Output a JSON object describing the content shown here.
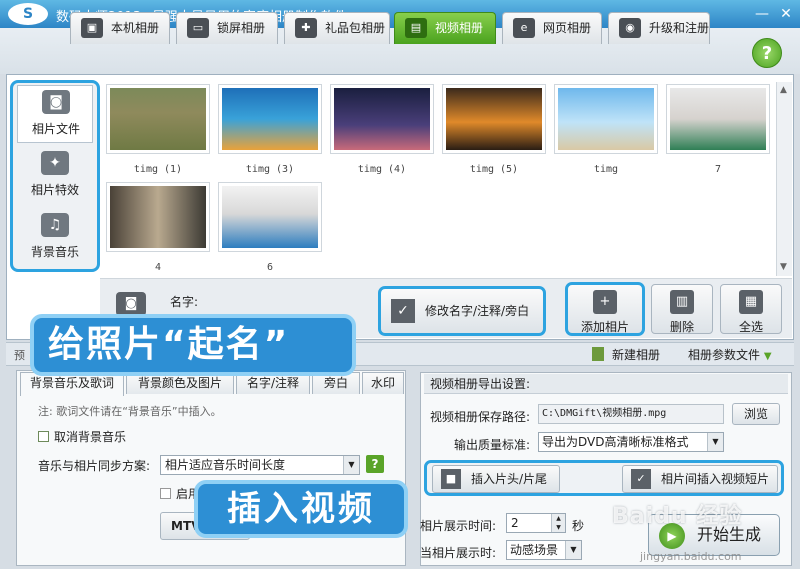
{
  "titlebar": {
    "app_name": "数码大师2013",
    "subtitle": "最强大最易用的家庭相册制作软件",
    "logo": "S",
    "minimize": "—",
    "close": "✕"
  },
  "tabs": [
    {
      "label": "本机相册",
      "icon": "computer-icon"
    },
    {
      "label": "锁屏相册",
      "icon": "monitor-icon"
    },
    {
      "label": "礼品包相册",
      "icon": "gift-icon"
    },
    {
      "label": "视频相册",
      "icon": "film-icon",
      "active": true
    },
    {
      "label": "网页相册",
      "icon": "ie-icon"
    },
    {
      "label": "升级和注册",
      "icon": "globe-icon"
    }
  ],
  "help": "?",
  "sidebar": {
    "items": [
      {
        "label": "相片文件",
        "icon": "camera-icon",
        "glyph": "◙",
        "active": true
      },
      {
        "label": "相片特效",
        "icon": "effects-icon",
        "glyph": "✦"
      },
      {
        "label": "背景音乐",
        "icon": "music-icon",
        "glyph": "♫"
      }
    ]
  },
  "gallery": {
    "photos": [
      {
        "caption": "timg (1)",
        "thumb": "sheep-herd-field"
      },
      {
        "caption": "timg (3)",
        "thumb": "underwater-coral-fish"
      },
      {
        "caption": "timg (4)",
        "thumb": "mountain-starry-sky"
      },
      {
        "caption": "timg (5)",
        "thumb": "sunset-clouds"
      },
      {
        "caption": "timg",
        "thumb": "beach-people"
      },
      {
        "caption": "7",
        "thumb": "billiards-man"
      },
      {
        "caption": "4",
        "thumb": "billiards-woman-cue"
      },
      {
        "caption": "6",
        "thumb": "billiards-woman-table"
      }
    ]
  },
  "name_label": "名字:",
  "buttons": {
    "rename": "修改名字/注释/旁白",
    "add_photo": "添加相片",
    "delete": "删除",
    "select_all": "全选"
  },
  "overlays": {
    "name_photo": "给照片“起名”",
    "insert_video": "插入视频"
  },
  "midbar": {
    "label": "预",
    "new_album": "新建相册",
    "album_params": "相册参数文件"
  },
  "settings_tabs": [
    "背景音乐及歌词",
    "背景颜色及图片",
    "名字/注释",
    "旁白",
    "水印"
  ],
  "music": {
    "note": "注: 歌词文件请在“背景音乐”中插入。",
    "cancel_music": "取消背景音乐",
    "sync_label": "音乐与相片同步方案:",
    "sync_value": "相片适应音乐时间长度",
    "help": "?",
    "enable_label": "启用",
    "mtv_label": "MTV"
  },
  "export": {
    "title": "视频相册导出设置:",
    "path_label": "视频相册保存路径:",
    "path_value": "C:\\DMGift\\视频相册.mpg",
    "browse": "浏览",
    "quality_label": "输出质量标准:",
    "quality_value": "导出为DVD高清晰标准格式",
    "insert_head": "插入片头/片尾",
    "insert_clip": "相片间插入视频短片",
    "duration_label": "相片展示时间:",
    "duration_value": "2",
    "duration_unit": "秒",
    "current_duration_label": "当相片展示时:",
    "current_duration_value": "动感场景",
    "generate": "开始生成"
  },
  "watermark": {
    "main": "Baidu 经验",
    "sub": "jingyan.baidu.com"
  },
  "colors": {
    "accent_blue": "#2da3e0",
    "active_tab_green": "#4aa21e",
    "titlebar": "#2d85c6"
  }
}
